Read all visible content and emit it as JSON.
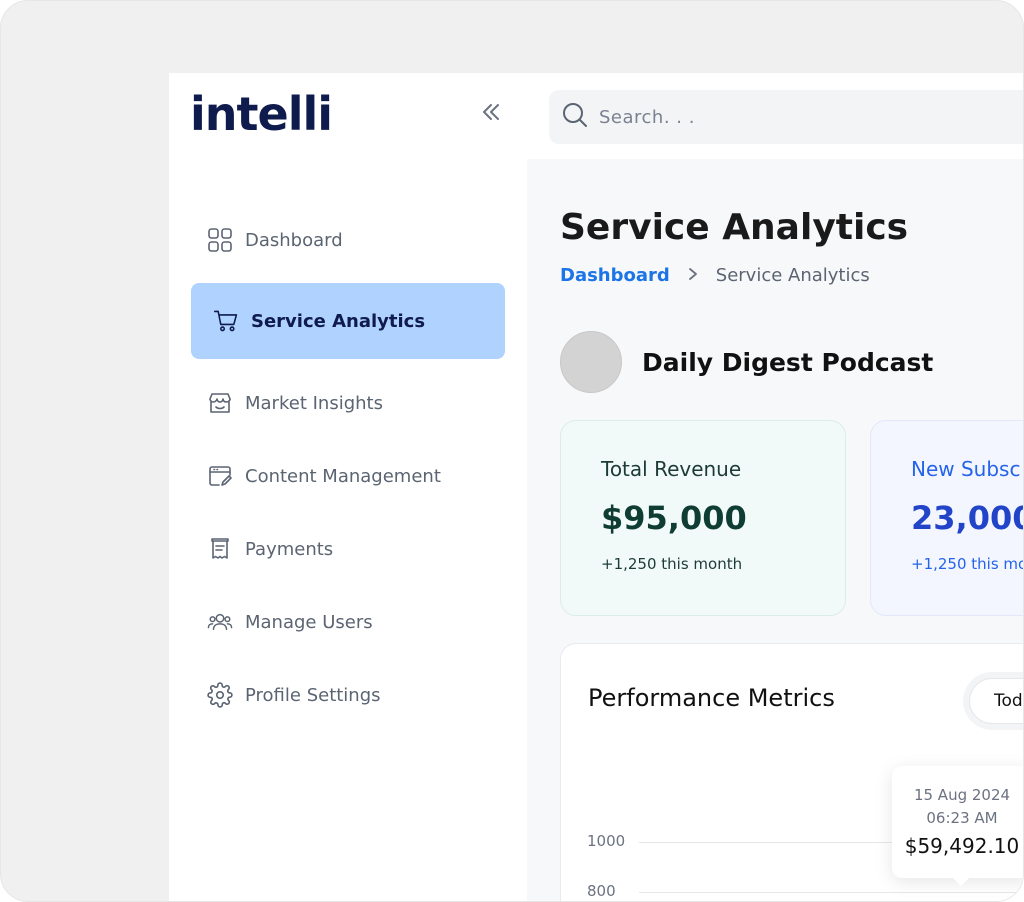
{
  "brand": {
    "logo_text": "intelli"
  },
  "sidebar": {
    "collapse_icon": "chevrons-left-icon",
    "items": [
      {
        "label": "Dashboard",
        "icon": "grid-icon",
        "active": false
      },
      {
        "label": "Service Analytics",
        "icon": "cart-icon",
        "active": true
      },
      {
        "label": "Market Insights",
        "icon": "storefront-icon",
        "active": false
      },
      {
        "label": "Content Management",
        "icon": "content-edit-icon",
        "active": false
      },
      {
        "label": "Payments",
        "icon": "receipt-icon",
        "active": false
      },
      {
        "label": "Manage Users",
        "icon": "users-icon",
        "active": false
      },
      {
        "label": "Profile Settings",
        "icon": "gear-icon",
        "active": false
      }
    ]
  },
  "search": {
    "placeholder": "Search. . .",
    "icon": "search-icon"
  },
  "page": {
    "title": "Service Analytics",
    "breadcrumb": {
      "link": "Dashboard",
      "current": "Service Analytics"
    },
    "podcast_name": "Daily Digest Podcast"
  },
  "cards": [
    {
      "label": "Total Revenue",
      "value": "$95,000",
      "sub": "+1,250 this month",
      "color": "#0f3d34"
    },
    {
      "label": "New Subsc",
      "value": "23,000",
      "sub": "+1,250 this mor",
      "color": "#2244c9"
    }
  ],
  "performance": {
    "title": "Performance Metrics",
    "range_label": "Tod",
    "y_ticks": [
      "1000",
      "800"
    ],
    "tooltip": {
      "date": "15 Aug 2024",
      "time": "06:23 AM",
      "value": "$59,492.10"
    }
  },
  "colors": {
    "accent": "#1c74e6",
    "active_nav_bg": "#afd2ff",
    "brand": "#0f1a4d"
  }
}
